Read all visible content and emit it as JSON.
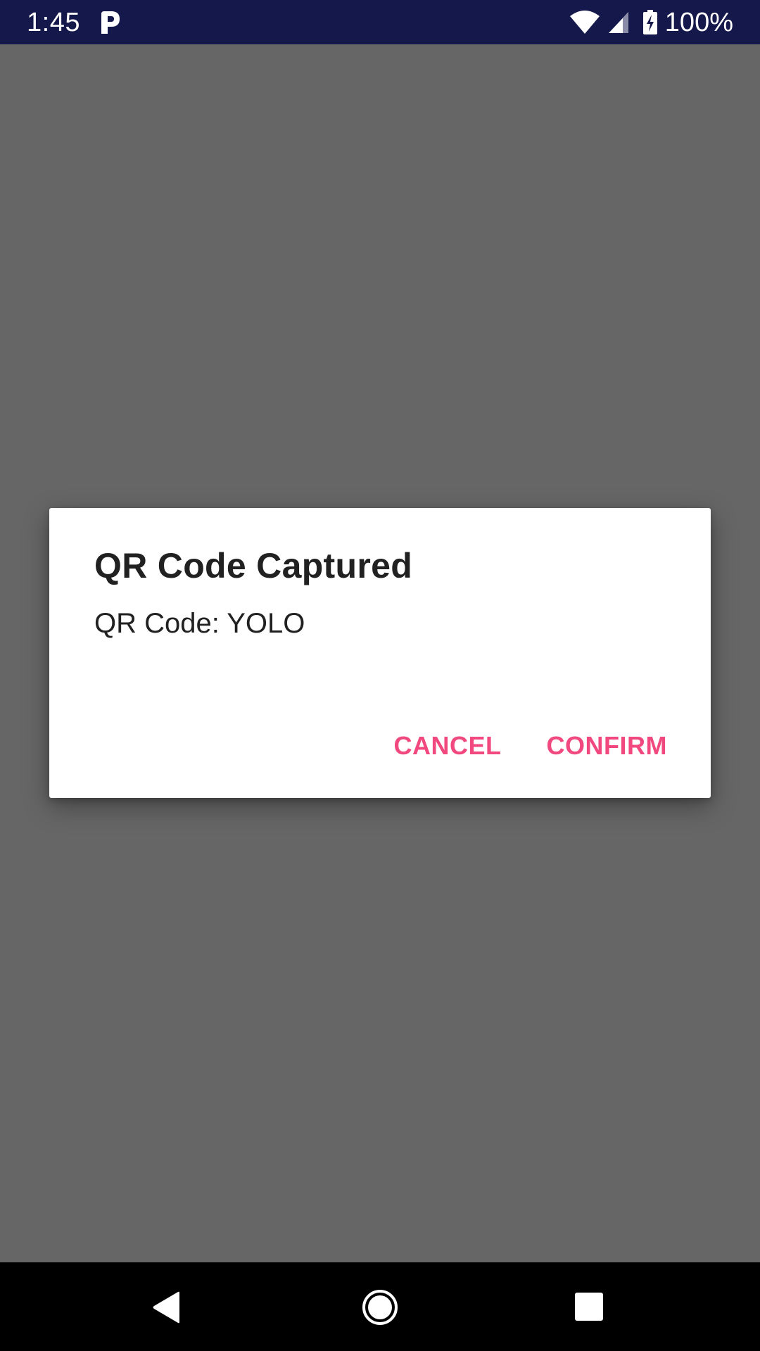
{
  "status_bar": {
    "time": "1:45",
    "notification_icon": "parking-p-icon",
    "wifi_icon": "wifi-icon",
    "signal_icon": "cell-signal-icon",
    "battery_icon": "battery-charging-icon",
    "battery_percent": "100%",
    "background_color": "#14184a"
  },
  "dialog": {
    "title": "QR Code Captured",
    "message": "QR Code: YOLO",
    "cancel_label": "CANCEL",
    "confirm_label": "CONFIRM",
    "accent_color": "#f0487f"
  },
  "nav_bar": {
    "back_icon": "back-triangle-icon",
    "home_icon": "home-circle-icon",
    "recents_icon": "recents-square-icon"
  },
  "scrim_color": "#666666"
}
